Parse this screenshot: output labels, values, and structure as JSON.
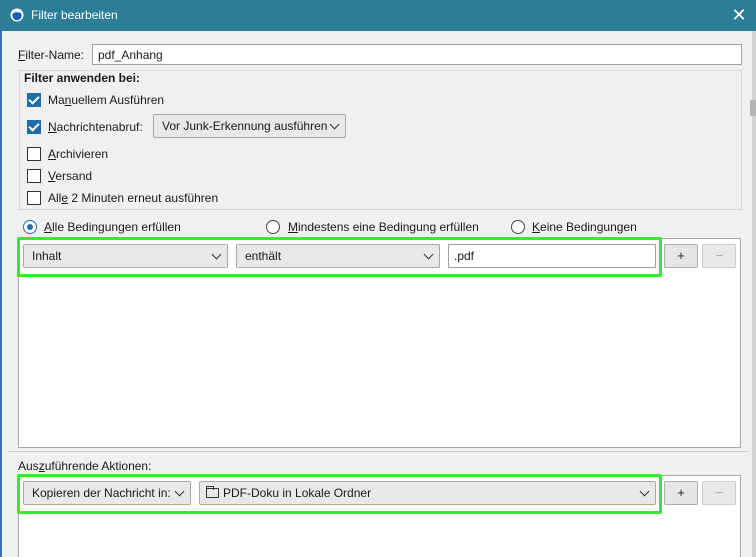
{
  "window": {
    "title": "Filter bearbeiten",
    "close_symbol": "✕"
  },
  "filter_name": {
    "label_pre": "",
    "label_key": "F",
    "label_post": "ilter-Name:",
    "value": "pdf_Anhang"
  },
  "apply_section": {
    "heading": "Filter anwenden bei:",
    "items": [
      {
        "pre": "Ma",
        "key": "n",
        "post": "uellem Ausführen",
        "checked": true
      },
      {
        "pre": "",
        "key": "N",
        "post": "achrichtenabruf:",
        "checked": true
      },
      {
        "pre": "",
        "key": "A",
        "post": "rchivieren",
        "checked": false
      },
      {
        "pre": "",
        "key": "V",
        "post": "ersand",
        "checked": false
      },
      {
        "pre": "All",
        "key": "e",
        "post": " 2 Minuten erneut ausführen",
        "checked": false
      }
    ],
    "junk_select": "Vor Junk-Erkennung ausführen"
  },
  "match_mode": {
    "options": [
      {
        "pre": "",
        "key": "A",
        "post": "lle Bedingungen erfüllen",
        "selected": true
      },
      {
        "pre": "",
        "key": "M",
        "post": "indestens eine Bedingung erfüllen",
        "selected": false
      },
      {
        "pre": "",
        "key": "K",
        "post": "eine Bedingungen",
        "selected": false
      }
    ]
  },
  "condition": {
    "field": "Inhalt",
    "operator": "enthält",
    "value": ".pdf",
    "add_label": "+",
    "remove_label": "−"
  },
  "actions": {
    "heading_pre": "Aus",
    "heading_key": "z",
    "heading_post": "uführende Aktionen:",
    "action": "Kopieren der Nachricht in:",
    "target_folder": "PDF-Doku in Lokale Ordner",
    "add_label": "+",
    "remove_label": "−"
  },
  "colors": {
    "titlebar": "#2e7d96",
    "accent": "#1c6fa8",
    "highlight": "#39e639"
  }
}
